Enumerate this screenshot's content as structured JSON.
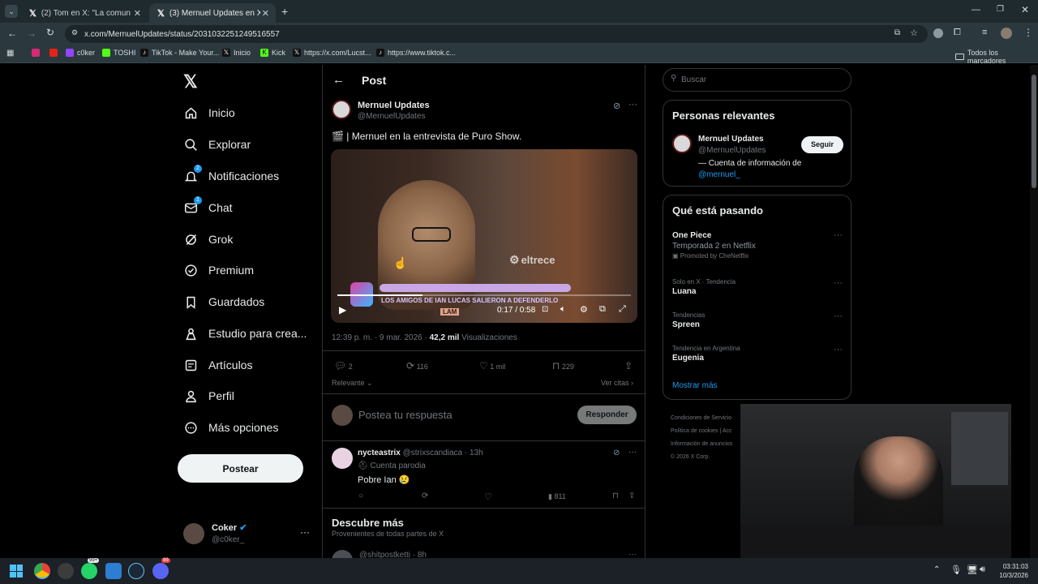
{
  "tabs": [
    {
      "title": "(2) Tom en X: \"La comunidad a"
    },
    {
      "title": "(3) Mernuel Updates en X: \""
    }
  ],
  "address": {
    "url": "x.com/MernuelUpdates/status/2031032251249516557"
  },
  "bookmarks": [
    "c0ker",
    "TOSHI",
    "TikTok - Make Your...",
    "Inicio",
    "Kick",
    "https://x.com/Lucst...",
    "https://www.tiktok.c...",
    "Todos los marcadores"
  ],
  "nav": {
    "items": [
      "Inicio",
      "Explorar",
      "Notificaciones",
      "Chat",
      "Grok",
      "Premium",
      "Guardados",
      "Estudio para crea...",
      "Artículos",
      "Perfil",
      "Más opciones"
    ],
    "notif_badge": "2",
    "chat_badge": "1",
    "post_label": "Postear",
    "user_name": "Coker",
    "user_handle": "@c0ker_"
  },
  "main": {
    "header": "Post",
    "author_name": "Mernuel Updates",
    "author_handle": "@MernuelUpdates",
    "text": "🎬 | Mernuel en la entrevista de Puro Show.",
    "video": {
      "channel_logo": "eltrece",
      "overlay_text": "LOS AMIGOS DE IAN LUCAS SALIERON A DEFENDERLO",
      "lam_tag": "LAM",
      "time": "0:17 / 0:58",
      "progress": 0.29
    },
    "meta_time": "12:39 p. m. · 9 mar. 2026 · ",
    "views_count": "42,2 mil",
    "views_label": " Visualizaciones",
    "stats": {
      "replies": "2",
      "reposts": "116",
      "likes": "1 mil",
      "bookmarks": "229"
    },
    "sort_label": "Relevante",
    "quotes_label": "Ver citas",
    "reply_placeholder": "Postea tu respuesta",
    "reply_button": "Responder",
    "reply": {
      "name": "nycteastrix",
      "handle_time": "@strixscandiaca · 13h",
      "parody": "Cuenta parodia",
      "text": "Pobre Ian 😢",
      "views": "811"
    },
    "discover_title": "Descubre más",
    "discover_sub": "Provenientes de todas partes de X",
    "next_handle": "@shitpostketti · 8h"
  },
  "right": {
    "search_placeholder": "Buscar",
    "people_title": "Personas relevantes",
    "person_name": "Mernuel Updates",
    "person_handle": "@MernuelUpdates",
    "follow_label": "Seguir",
    "person_bio": "— Cuenta de información de",
    "person_bio_link": "@mernuel_",
    "trending_title": "Qué está pasando",
    "trends": [
      {
        "cat": "",
        "name": "One Piece",
        "sub": "Temporada 2 en Netflix",
        "promo": "Promoted by CheNetflix"
      },
      {
        "cat": "Solo en X · Tendencia",
        "name": "Luana"
      },
      {
        "cat": "Tendencias",
        "name": "Spreen"
      },
      {
        "cat": "Tendencia en Argentina",
        "name": "Eugenia"
      }
    ],
    "show_more": "Mostrar más",
    "footer": [
      "Condiciones de Servicio",
      "Política de cookies",
      "Acc",
      "Información de anuncios",
      "© 2026 X Corp."
    ]
  },
  "taskbar": {
    "time": "03:31:03",
    "date": "10/3/2026",
    "whatsapp_badge": "99+",
    "badge2": "99"
  },
  "colors": {
    "accent": "#1d9bf0",
    "bg": "#000000",
    "chrome": "#2b383d"
  }
}
